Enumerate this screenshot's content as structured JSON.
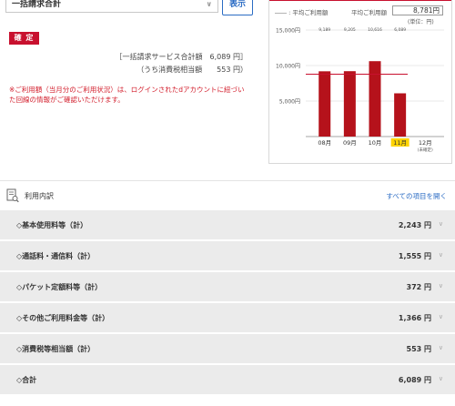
{
  "billing_select": {
    "value": "一括請求合計"
  },
  "show_button": "表示",
  "status_badge": "確 定",
  "summary": {
    "total_line": "［一括請求サービス合計額　6,089 円］",
    "tax_line": "（うち消費税相当額　　553 円）"
  },
  "note": "※ご利用額（当月分のご利用状況）は、ログインされたdアカウントに紐づいた回線の情報がご確認いただけます。",
  "chart_panel": {
    "legend": "―― : 平均ご利用額",
    "avg_label": "平均ご利用額",
    "avg_value": "8,781円",
    "unit": "(単位：円)"
  },
  "chart_data": {
    "type": "bar",
    "categories": [
      "08月",
      "09月",
      "10月",
      "11月",
      "12月"
    ],
    "values": [
      9189,
      9205,
      10616,
      6089,
      null
    ],
    "value_labels": [
      "9,189",
      "9,205",
      "10,616",
      "6,089",
      ""
    ],
    "sub_labels": [
      "",
      "",
      "",
      "",
      "(未確定)"
    ],
    "y_ticks": [
      "15,000円",
      "10,000円",
      "5,000円"
    ],
    "ylim": [
      0,
      15000
    ],
    "average": 8781,
    "highlight_category": "11月",
    "colors": {
      "bar": "#b5121b",
      "average_line": "#c8102e",
      "highlight": "#ffd400"
    }
  },
  "details": {
    "title": "利用内訳",
    "expand_all": "すべての項目を開く",
    "rows": [
      {
        "label": "◇基本使用料等（計）",
        "amount": "2,243 円"
      },
      {
        "label": "◇通話料・通信料（計）",
        "amount": "1,555 円"
      },
      {
        "label": "◇パケット定額料等（計）",
        "amount": "372 円"
      },
      {
        "label": "◇その他ご利用料金等（計）",
        "amount": "1,366 円"
      },
      {
        "label": "◇消費税等相当額（計）",
        "amount": "553 円"
      },
      {
        "label": "◇合計",
        "amount": "6,089 円"
      }
    ]
  }
}
